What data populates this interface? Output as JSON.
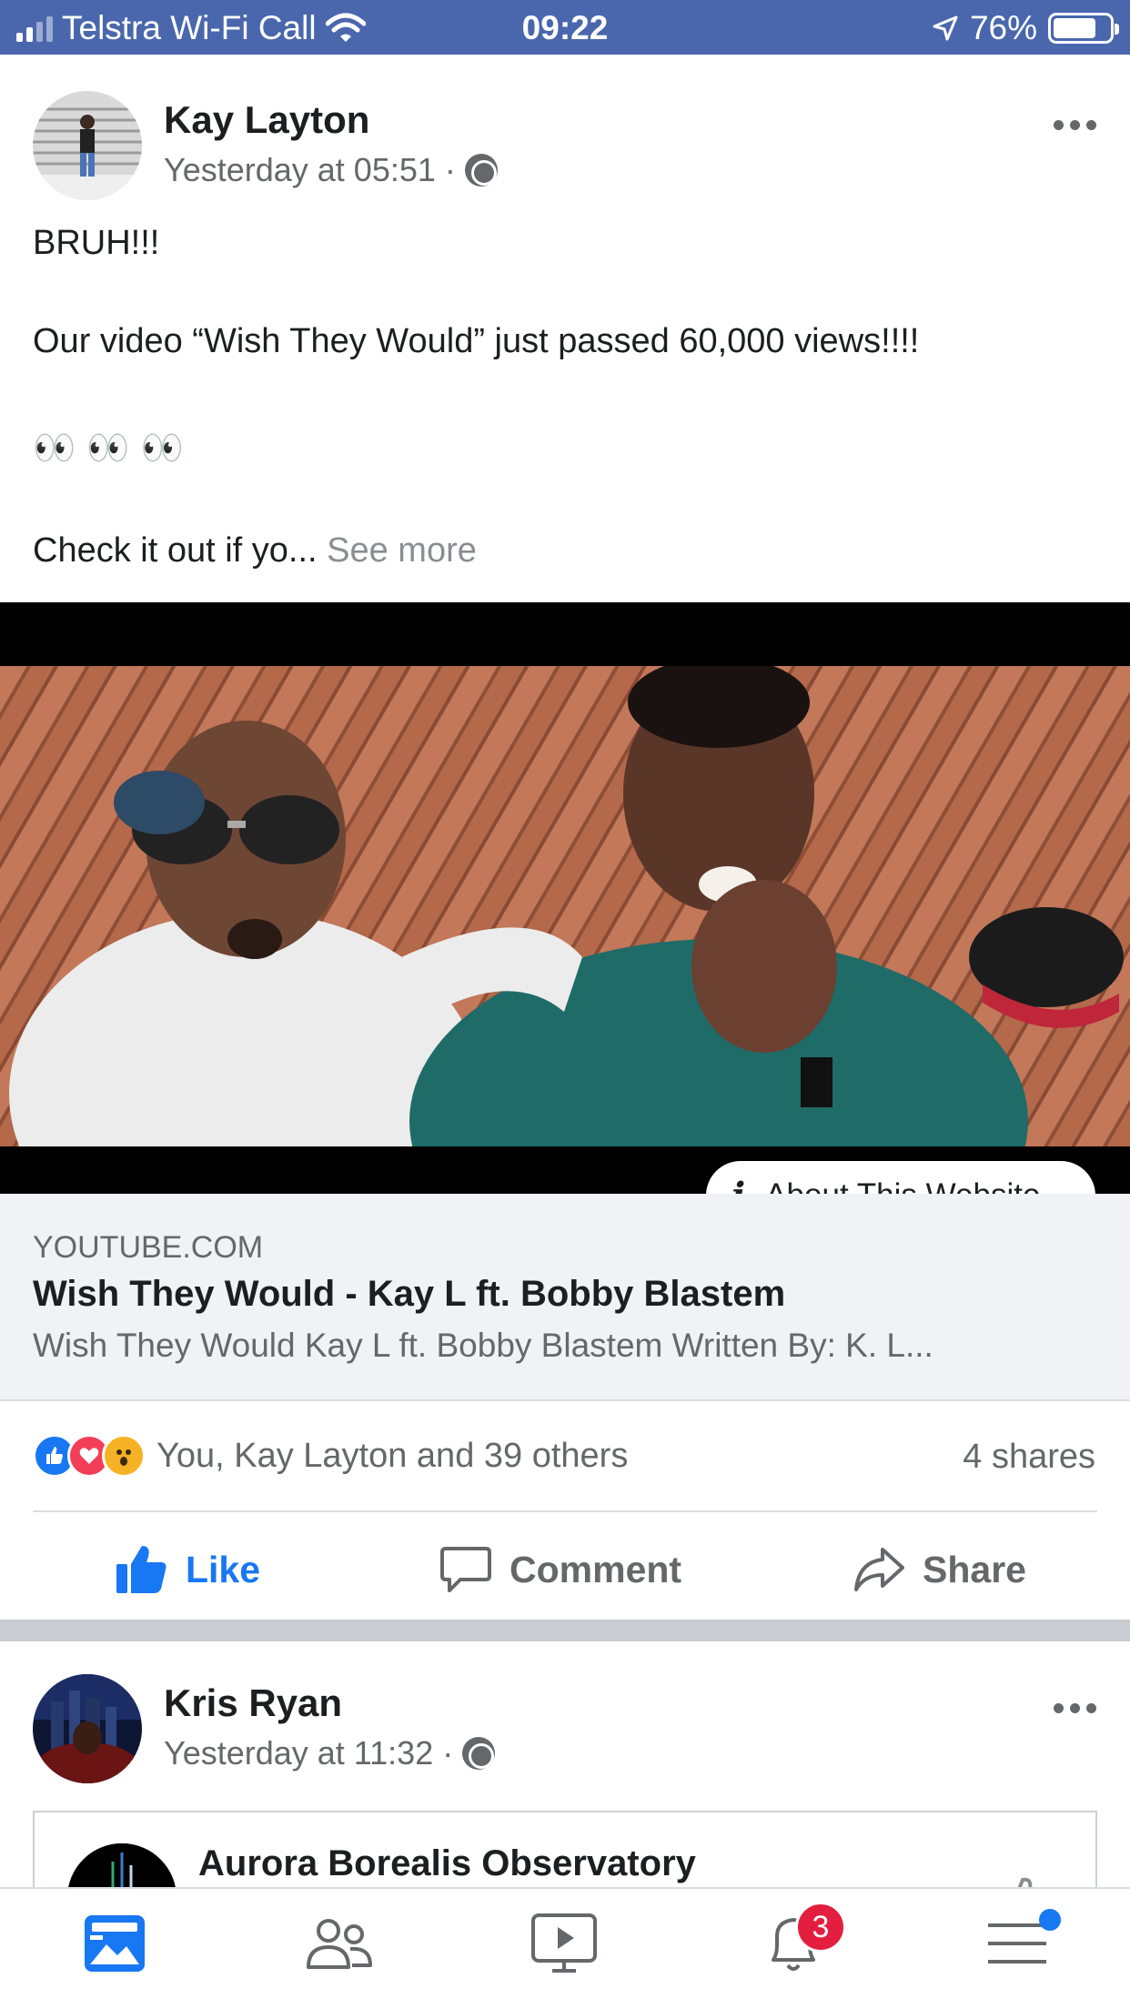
{
  "status_bar": {
    "carrier": "Telstra Wi-Fi Call",
    "time": "09:22",
    "battery": "76%",
    "battery_level": 0.76
  },
  "post1": {
    "author": "Kay Layton",
    "timestamp": "Yesterday at 05:51 ·",
    "text_line1": "BRUH!!!",
    "text_line2": "Our video “Wish They Would” just passed 60,000 views!!!!",
    "text_line3": "👀 👀 👀",
    "text_line4": "Check it out if yo...",
    "see_more": "See more",
    "about_website": "About This Website",
    "link": {
      "domain": "YOUTUBE.COM",
      "title": "Wish They Would - Kay L ft. Bobby Blastem",
      "description": "Wish They Would Kay L ft. Bobby Blastem Written By: K. L..."
    },
    "reactions_text": "You, Kay Layton and 39 others",
    "shares": "4 shares",
    "actions": {
      "like": "Like",
      "comment": "Comment",
      "share": "Share"
    }
  },
  "post2": {
    "author": "Kris Ryan",
    "timestamp": "Yesterday at 11:32 ·",
    "shared_page_title": "Aurora Borealis Observatory"
  },
  "tabbar": {
    "notifications_badge": "3",
    "icons": [
      "news-feed-icon",
      "friends-icon",
      "watch-icon",
      "notifications-icon",
      "menu-icon"
    ]
  },
  "colors": {
    "status_bar": "#4a67ad",
    "accent": "#1877f2",
    "badge": "#e41e3f"
  }
}
